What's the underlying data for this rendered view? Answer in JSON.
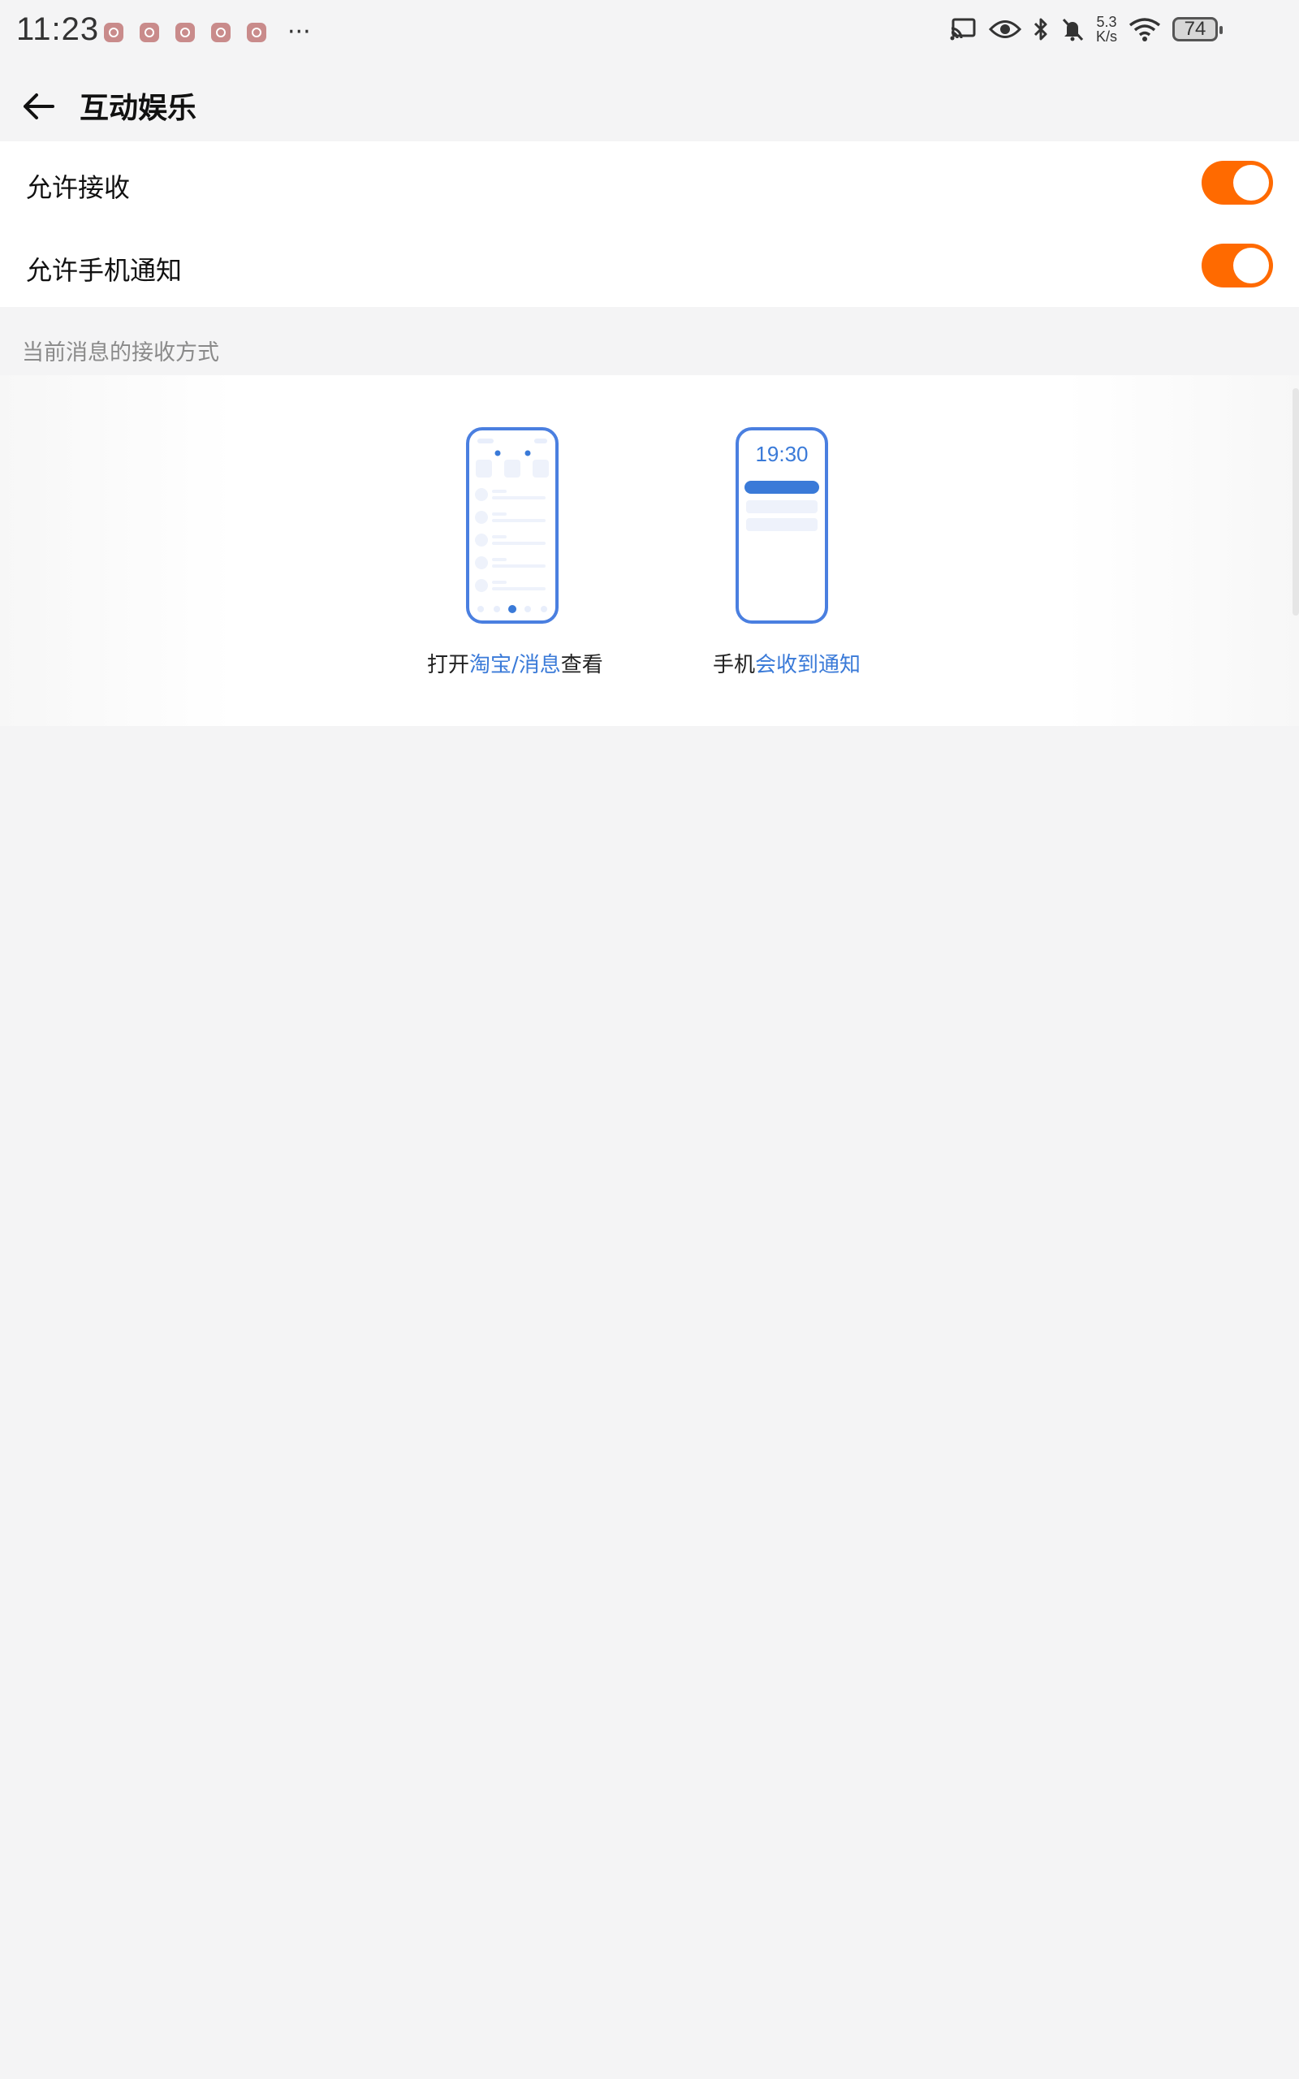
{
  "status_bar": {
    "time": "11:23",
    "more": "···",
    "net_speed_value": "5.3",
    "net_speed_unit": "K/s",
    "battery": "74"
  },
  "header": {
    "title": "互动娱乐"
  },
  "settings": {
    "allow_receive": {
      "label": "允许接收",
      "enabled": true
    },
    "allow_phone_notify": {
      "label": "允许手机通知",
      "enabled": true
    }
  },
  "section": {
    "label": "当前消息的接收方式"
  },
  "methods": {
    "open_app": {
      "prefix": "打开",
      "highlight": "淘宝/消息",
      "suffix": "查看"
    },
    "phone_notify": {
      "prefix": "手机",
      "highlight": "会收到通知",
      "phone_time": "19:30"
    }
  },
  "colors": {
    "accent_orange": "#ff6a00",
    "accent_blue": "#3a7ad8",
    "background": "#f4f4f5"
  }
}
